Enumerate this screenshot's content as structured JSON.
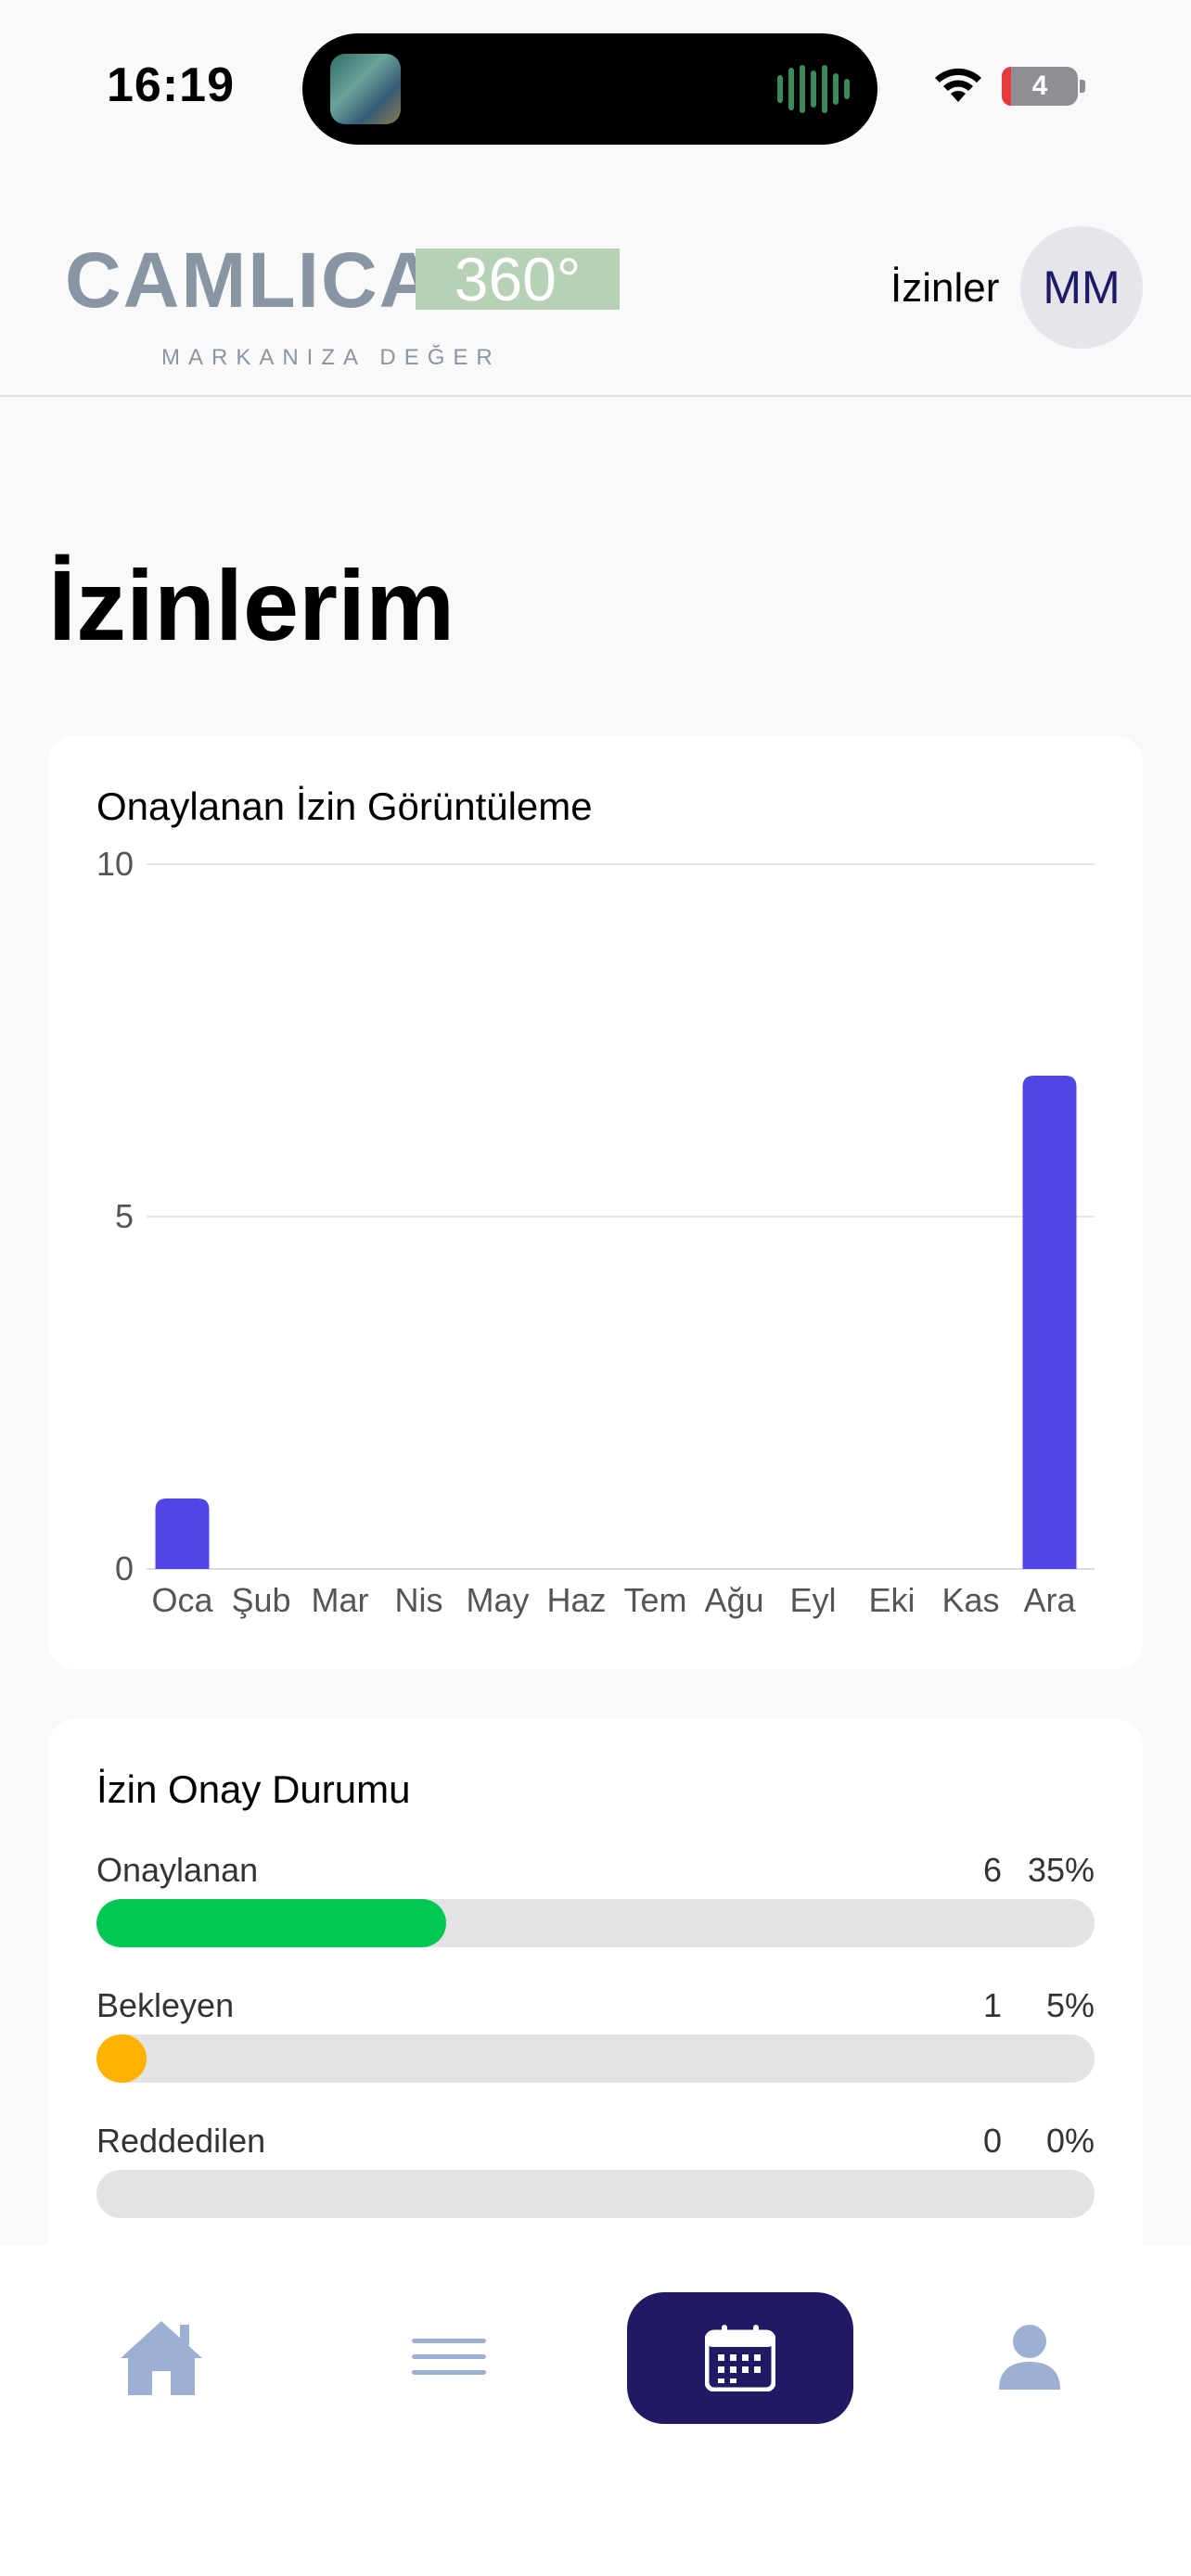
{
  "status_bar": {
    "time": "16:19",
    "battery": "4"
  },
  "header": {
    "logo_word": "CAMLICA",
    "logo_badge": "360°",
    "logo_tagline": "MARKANIZA DEĞER",
    "nav_label": "İzinler",
    "avatar_initials": "MM"
  },
  "page": {
    "title": "İzinlerim"
  },
  "chart_card": {
    "title": "Onaylanan İzin Görüntüleme"
  },
  "chart_data": {
    "type": "bar",
    "title": "Onaylanan İzin Görüntüleme",
    "categories": [
      "Oca",
      "Şub",
      "Mar",
      "Nis",
      "May",
      "Haz",
      "Tem",
      "Ağu",
      "Eyl",
      "Eki",
      "Kas",
      "Ara"
    ],
    "values": [
      1,
      0,
      0,
      0,
      0,
      0,
      0,
      0,
      0,
      0,
      0,
      7
    ],
    "ylim": [
      0,
      10
    ],
    "yticks": [
      "0",
      "5",
      "10"
    ],
    "grid": true,
    "color": "#4f46e5"
  },
  "status_card": {
    "title": "İzin Onay Durumu",
    "rows": [
      {
        "label": "Onaylanan",
        "count": "6",
        "percent": "35%",
        "fraction": 0.35,
        "color": "#00c853"
      },
      {
        "label": "Bekleyen",
        "count": "1",
        "percent": "5%",
        "fraction": 0.05,
        "color": "#ffb300"
      },
      {
        "label": "Reddedilen",
        "count": "0",
        "percent": "0%",
        "fraction": 0,
        "color": "#e53935"
      }
    ]
  },
  "tabbar": {
    "items": [
      {
        "icon": "home-icon"
      },
      {
        "icon": "menu-icon"
      },
      {
        "icon": "calendar-icon",
        "active": true
      },
      {
        "icon": "profile-icon"
      }
    ],
    "active_color": "#1f1a63",
    "icon_color": "#9db0d3"
  }
}
